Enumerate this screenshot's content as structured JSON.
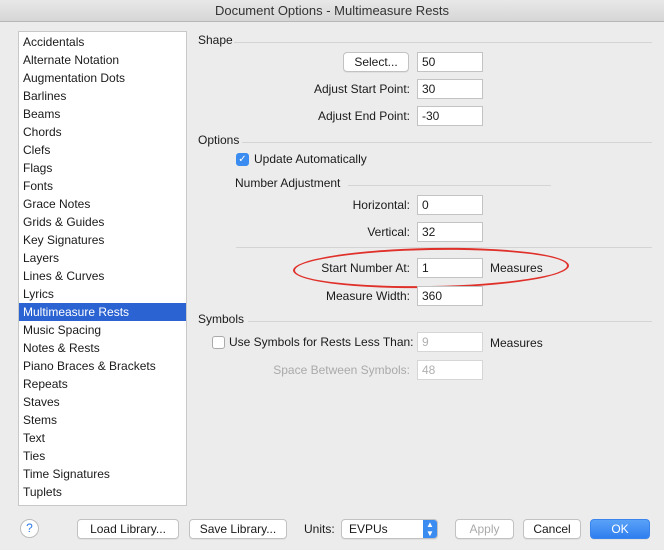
{
  "window": {
    "title": "Document Options - Multimeasure Rests"
  },
  "sidebar": {
    "items": [
      "Accidentals",
      "Alternate Notation",
      "Augmentation Dots",
      "Barlines",
      "Beams",
      "Chords",
      "Clefs",
      "Flags",
      "Fonts",
      "Grace Notes",
      "Grids & Guides",
      "Key Signatures",
      "Layers",
      "Lines & Curves",
      "Lyrics",
      "Multimeasure Rests",
      "Music Spacing",
      "Notes & Rests",
      "Piano Braces & Brackets",
      "Repeats",
      "Staves",
      "Stems",
      "Text",
      "Ties",
      "Time Signatures",
      "Tuplets"
    ],
    "selected": "Multimeasure Rests"
  },
  "shape": {
    "title": "Shape",
    "select_label": "Select...",
    "select_value": "50",
    "start_label": "Adjust Start Point:",
    "start_value": "30",
    "end_label": "Adjust End Point:",
    "end_value": "-30"
  },
  "options": {
    "title": "Options",
    "update_label": "Update Automatically",
    "update_checked": true,
    "numadj_title": "Number Adjustment",
    "horizontal_label": "Horizontal:",
    "horizontal_value": "0",
    "vertical_label": "Vertical:",
    "vertical_value": "32",
    "start_number_label": "Start Number At:",
    "start_number_value": "1",
    "start_number_unit": "Measures",
    "measure_width_label": "Measure Width:",
    "measure_width_value": "360",
    "highlight_color": "#e0302a"
  },
  "symbols": {
    "title": "Symbols",
    "use_label": "Use Symbols for Rests Less Than:",
    "use_checked": false,
    "use_value": "9",
    "use_unit": "Measures",
    "space_label": "Space Between Symbols:",
    "space_value": "48"
  },
  "footer": {
    "help": "?",
    "load": "Load Library...",
    "save": "Save Library...",
    "units_label": "Units:",
    "units_value": "EVPUs",
    "apply": "Apply",
    "cancel": "Cancel",
    "ok": "OK"
  }
}
